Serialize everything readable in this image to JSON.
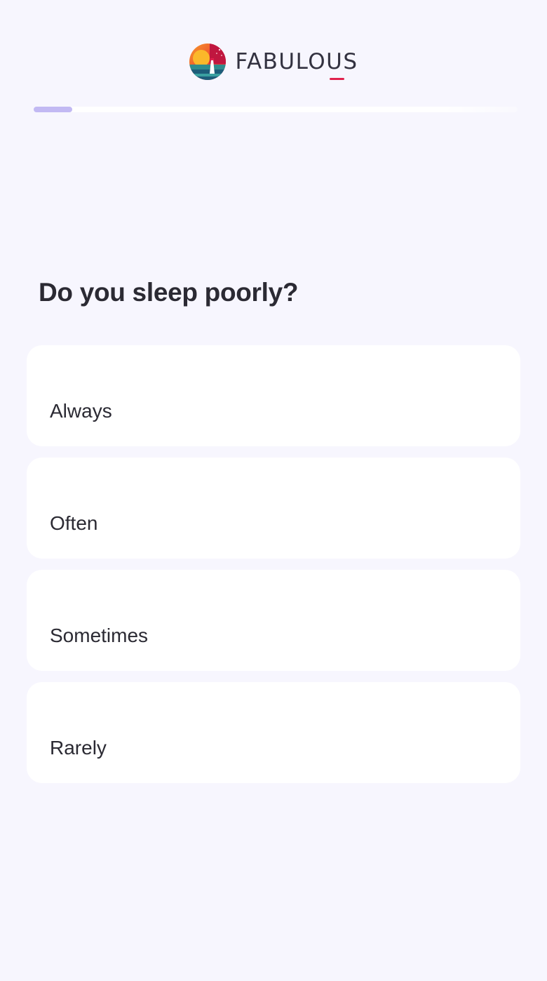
{
  "brand": {
    "name": "FABULOUS",
    "logo_icon": "sunset-lighthouse-icon",
    "accent_color": "#e0214c"
  },
  "progress": {
    "fraction": 0.08,
    "fill_color": "#c2b9f3"
  },
  "question": {
    "title": "Do you sleep poorly?"
  },
  "options": [
    {
      "label": "Always"
    },
    {
      "label": "Often"
    },
    {
      "label": "Sometimes"
    },
    {
      "label": "Rarely"
    }
  ]
}
